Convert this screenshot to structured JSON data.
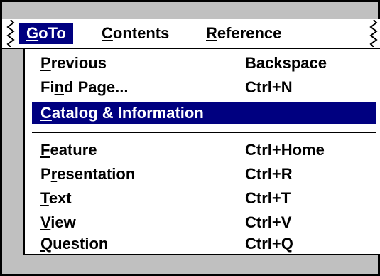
{
  "menubar": {
    "items": [
      {
        "accel": "G",
        "rest": "oTo",
        "active": true
      },
      {
        "accel": "C",
        "rest": "ontents",
        "active": false
      },
      {
        "accel": "R",
        "rest": "eference",
        "active": false
      }
    ]
  },
  "menu": {
    "items": [
      {
        "pre": "",
        "accel": "P",
        "post": "revious",
        "shortcut": "Backspace"
      },
      {
        "pre": "Fi",
        "accel": "n",
        "post": "d Page...",
        "shortcut": "Ctrl+N"
      },
      {
        "pre": "",
        "accel": "C",
        "post": "atalog & Information",
        "shortcut": "",
        "selected": true
      },
      {
        "pre": "",
        "accel": "F",
        "post": "eature",
        "shortcut": "Ctrl+Home"
      },
      {
        "pre": "P",
        "accel": "r",
        "post": "esentation",
        "shortcut": "Ctrl+R"
      },
      {
        "pre": "",
        "accel": "T",
        "post": "ext",
        "shortcut": "Ctrl+T"
      },
      {
        "pre": "",
        "accel": "V",
        "post": "iew",
        "shortcut": "Ctrl+V"
      },
      {
        "pre": "",
        "accel": "Q",
        "post": "uestion",
        "shortcut": "Ctrl+Q"
      }
    ]
  },
  "colors": {
    "highlight": "#000080",
    "background": "#c0c0c0",
    "menu": "#ffffff"
  }
}
